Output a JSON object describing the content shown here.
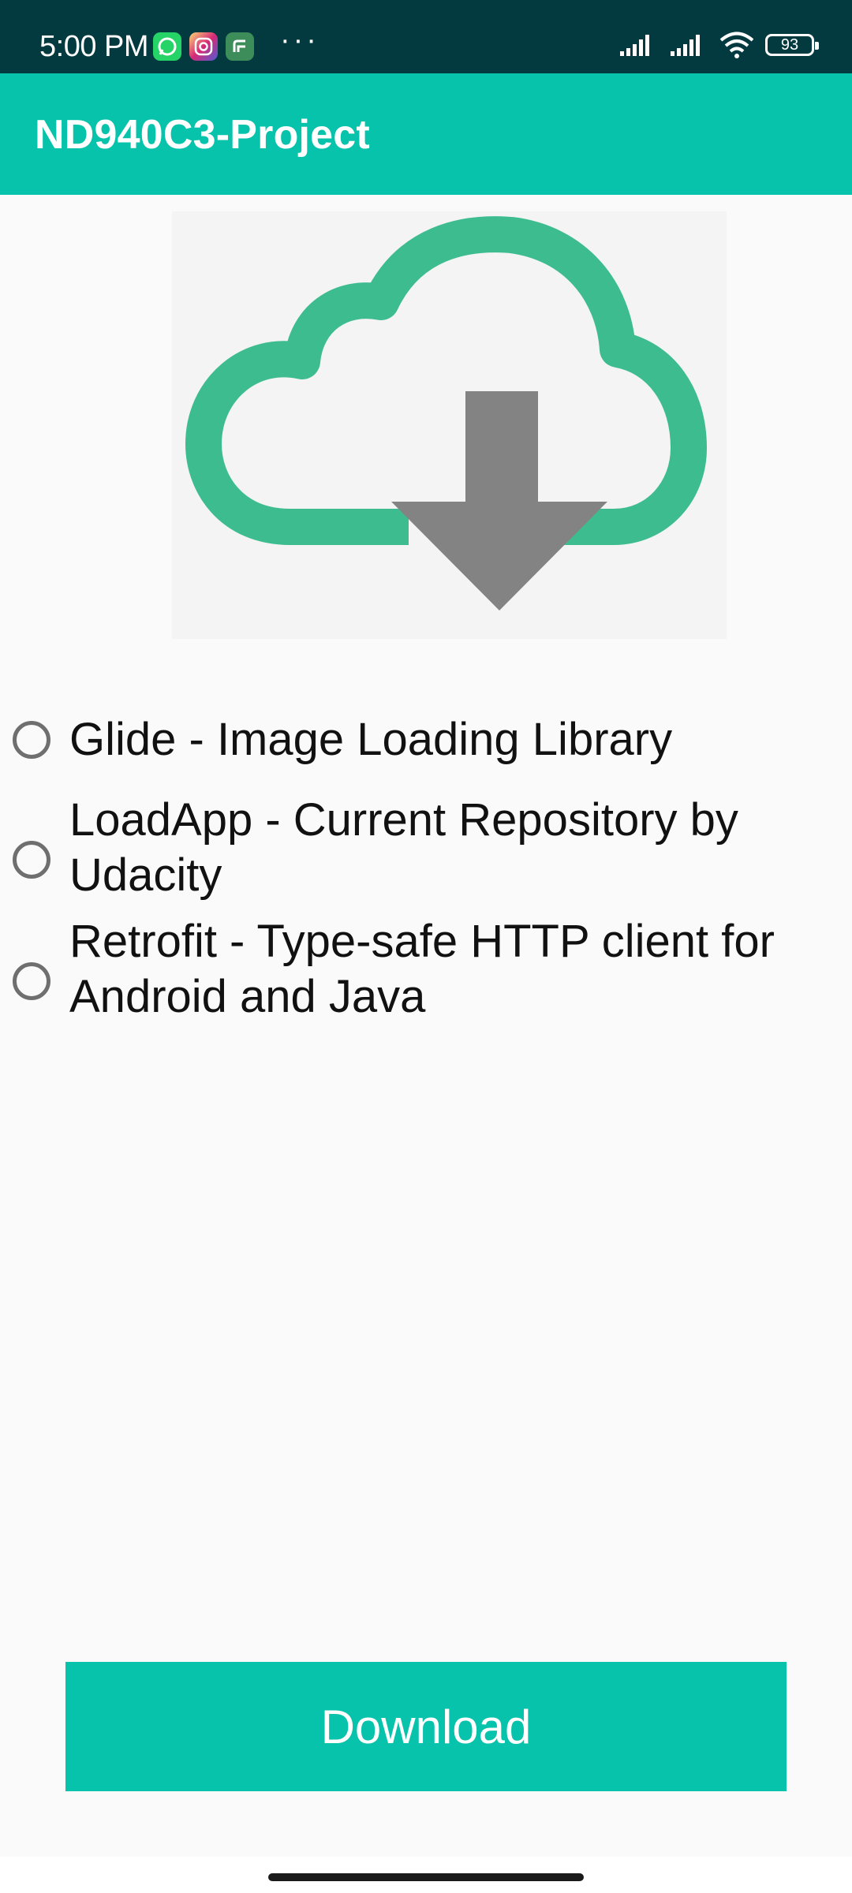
{
  "status_bar": {
    "time": "5:00 PM",
    "more": "···",
    "battery": "93",
    "notification_icons": [
      "whatsapp-icon",
      "instagram-icon",
      "feeds-icon"
    ]
  },
  "app_bar": {
    "title": "ND940C3-Project"
  },
  "hero": {
    "icon": "cloud-download-icon",
    "colors": {
      "cloud": "#3dbd8f",
      "arrow": "#838383"
    }
  },
  "options": [
    {
      "label": "Glide - Image Loading Library",
      "selected": false
    },
    {
      "label": "LoadApp - Current Repository by Udacity",
      "selected": false
    },
    {
      "label": "Retrofit - Type-safe HTTP client for Android and Java",
      "selected": false
    }
  ],
  "download_button": {
    "label": "Download"
  },
  "colors": {
    "accent": "#07c3ab",
    "status_bar": "#033a40",
    "background": "#fafafa"
  }
}
